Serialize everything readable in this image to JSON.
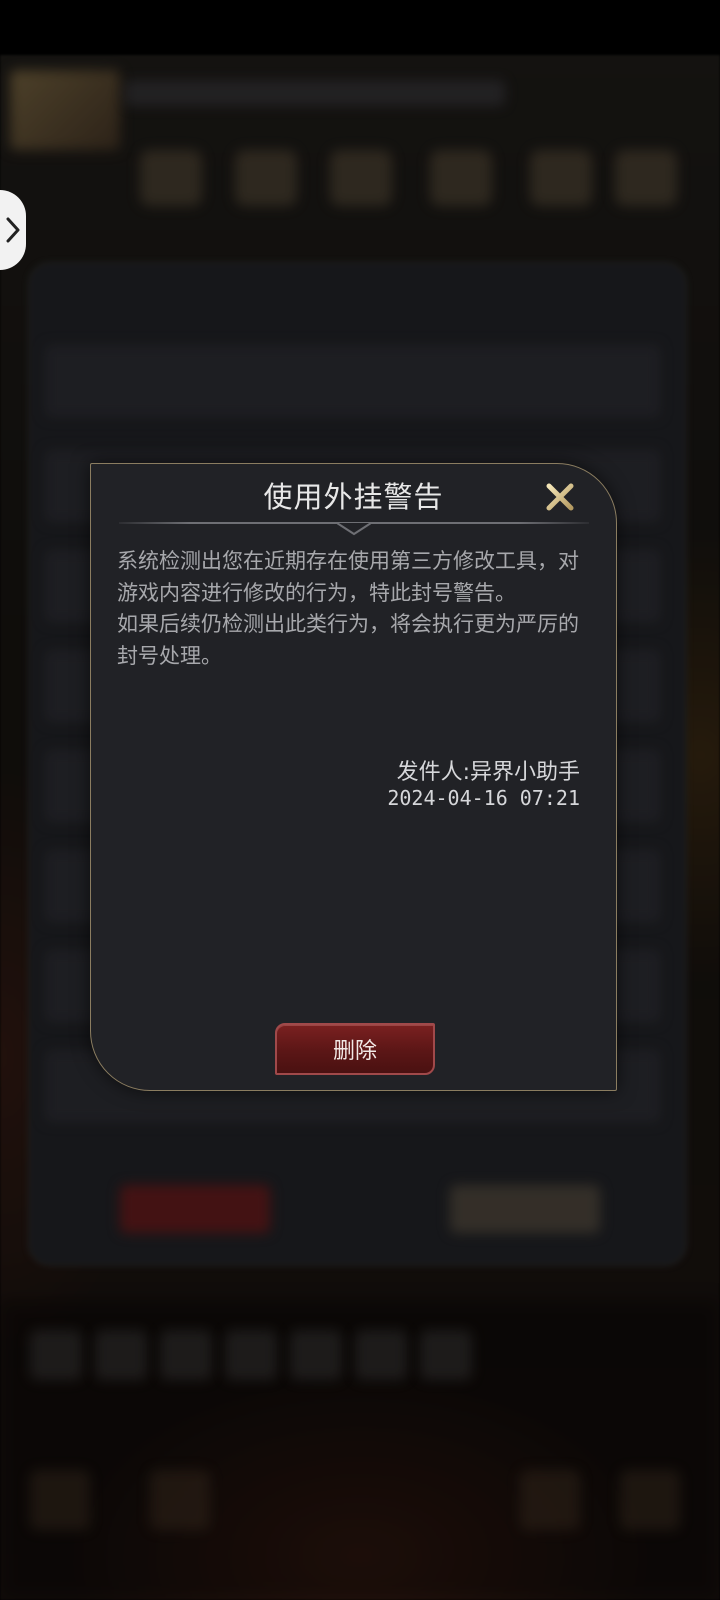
{
  "dialog": {
    "title": "使用外挂警告",
    "body": "系统检测出您在近期存在使用第三方修改工具，对游戏内容进行修改的行为，特此封号警告。\n如果后续仍检测出此类行为，将会执行更为严厉的封号处理。",
    "sender": "发件人:异界小助手",
    "date": "2024-04-16 07:21",
    "delete_label": "删除"
  },
  "colors": {
    "dialog_bg": "#212226",
    "dialog_border": "#8b7d60",
    "close_icon": "#d8c79a",
    "delete_button": "#6b1c1c"
  },
  "icons": {
    "close": "close-icon",
    "side_handle": "chevron-right-icon"
  }
}
